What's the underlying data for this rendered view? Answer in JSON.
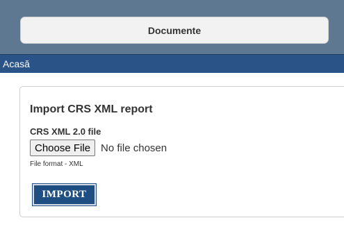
{
  "header": {
    "nav_button_label": "Documente"
  },
  "breadcrumb": {
    "home_label": "Acasă"
  },
  "import_card": {
    "title": "Import CRS XML report",
    "field_label": "CRS XML 2.0 file",
    "choose_file_label": "Choose File",
    "file_status": "No file chosen",
    "hint": "File format - XML",
    "import_label": "IMPORT"
  },
  "colors": {
    "header_background": "#5f7891",
    "breadcrumb_background": "#2a5388",
    "import_button_background": "#1f4f82"
  }
}
